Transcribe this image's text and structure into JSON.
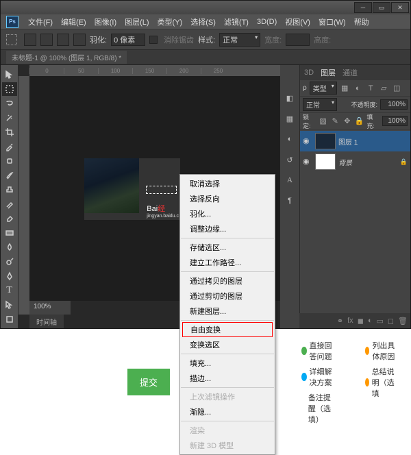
{
  "menu": {
    "file": "文件(F)",
    "edit": "编辑(E)",
    "image": "图像(I)",
    "layer": "图层(L)",
    "type": "类型(Y)",
    "select": "选择(S)",
    "filter": "滤镜(T)",
    "td": "3D(D)",
    "view": "视图(V)",
    "window": "窗口(W)",
    "help": "帮助"
  },
  "options": {
    "feather_label": "羽化:",
    "feather_value": "0 像素",
    "antialias": "消除锯齿",
    "style_label": "样式:",
    "style_value": "正常",
    "width_label": "宽度:",
    "height_label": "高度:"
  },
  "doctab": "未标题-1 @ 100% (图层 1, RGB/8) *",
  "ruler_h": [
    "0",
    "50",
    "100",
    "150",
    "200",
    "250"
  ],
  "zoom": "100%",
  "timeline": "时间轴",
  "watermark": {
    "brand": "Bai",
    "red": "经",
    "sub": "jingyan.baidu.c"
  },
  "panel_tabs": {
    "td": "3D",
    "layers": "图层",
    "channels": "通道"
  },
  "layer_panel": {
    "kind": "类型",
    "blend": "正常",
    "opacity_label": "不透明度:",
    "opacity": "100%",
    "lock_label": "锁定:",
    "fill_label": "填充:",
    "fill": "100%",
    "layer1": "图层 1",
    "background": "背景"
  },
  "side_icons": {
    "history": "历史",
    "char": "A",
    "para": "¶"
  },
  "context_menu": [
    {
      "t": "取消选择"
    },
    {
      "t": "选择反向"
    },
    {
      "t": "羽化..."
    },
    {
      "t": "调整边缘..."
    },
    {
      "sep": true
    },
    {
      "t": "存储选区..."
    },
    {
      "t": "建立工作路径..."
    },
    {
      "sep": true
    },
    {
      "t": "通过拷贝的图层"
    },
    {
      "t": "通过剪切的图层"
    },
    {
      "t": "新建图层..."
    },
    {
      "sep": true
    },
    {
      "t": "自由变换",
      "hl": true
    },
    {
      "t": "变换选区"
    },
    {
      "sep": true
    },
    {
      "t": "填充..."
    },
    {
      "t": "描边..."
    },
    {
      "sep": true
    },
    {
      "t": "上次滤镜操作",
      "disabled": true
    },
    {
      "t": "渐隐..."
    },
    {
      "sep": true
    },
    {
      "t": "渲染",
      "disabled": true
    },
    {
      "t": "新建 3D 模型",
      "disabled": true
    }
  ],
  "page": {
    "col1a": "直接回答问题",
    "col1b": "详细解决方案",
    "col1c": "备注提醒（选填）",
    "col2a": "列出具体原因",
    "col2b": "总结说明（选填",
    "submit": "提交"
  }
}
